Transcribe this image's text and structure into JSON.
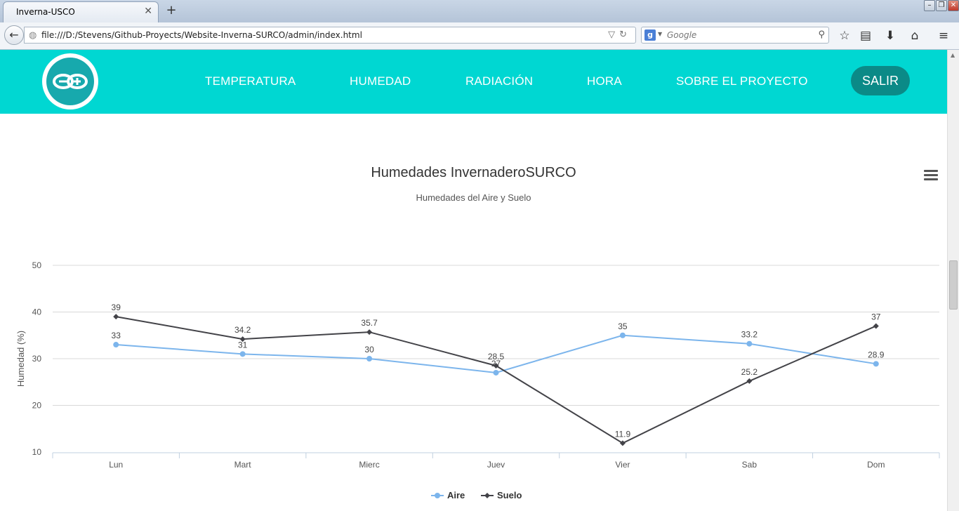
{
  "browser": {
    "tab_title": "Inverna-USCO",
    "url": "file:///D:/Stevens/Github-Proyects/Website-Inverna-SURCO/admin/index.html",
    "search_placeholder": "Google",
    "tab_close_icon": "close-icon",
    "new_tab_icon": "plus-icon"
  },
  "site": {
    "menu": [
      "TEMPERATURA",
      "HUMEDAD",
      "RADIACIÓN",
      "HORA",
      "SOBRE EL PROYECTO"
    ],
    "logout_label": "SALIR",
    "header_color": "#00d7d2"
  },
  "chart_data": {
    "type": "line",
    "title": "Humedades InvernaderoSURCO",
    "subtitle": "Humedades del Aire y Suelo",
    "xlabel": "",
    "ylabel": "Humedad (%)",
    "categories": [
      "Lun",
      "Mart",
      "Mierc",
      "Juev",
      "Vier",
      "Sab",
      "Dom"
    ],
    "ylim": [
      10,
      50
    ],
    "yticks": [
      10,
      20,
      30,
      40,
      50
    ],
    "grid": true,
    "legend_position": "bottom-center",
    "series": [
      {
        "name": "Aire",
        "values": [
          33,
          31,
          30,
          27,
          35,
          33.2,
          28.9
        ],
        "color": "#7cb5ec",
        "marker": "circle"
      },
      {
        "name": "Suelo",
        "values": [
          39,
          34.2,
          35.7,
          28.5,
          11.9,
          25.2,
          37
        ],
        "color": "#434348",
        "marker": "diamond"
      }
    ]
  }
}
